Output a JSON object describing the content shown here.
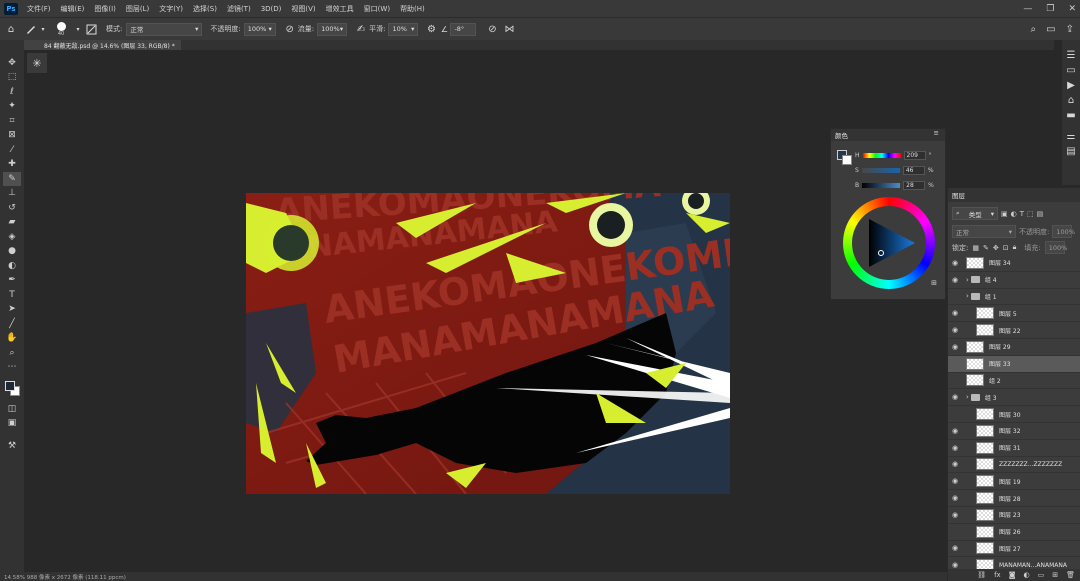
{
  "menubar": {
    "logo": "Ps",
    "items": [
      "文件(F)",
      "编辑(E)",
      "图像(I)",
      "图层(L)",
      "文字(Y)",
      "选择(S)",
      "滤镜(T)",
      "3D(D)",
      "视图(V)",
      "增效工具",
      "窗口(W)",
      "帮助(H)"
    ],
    "window_controls": [
      "—",
      "❐",
      "✕"
    ]
  },
  "options": {
    "brush_size": "40",
    "mode_label": "模式:",
    "mode_value": "正常",
    "opacity_label": "不透明度:",
    "opacity_value": "100%",
    "flow_label": "流量:",
    "flow_value": "100%",
    "smoothing_label": "平滑:",
    "smoothing_value": "10%",
    "angle_value": "-8°"
  },
  "document": {
    "tab_title": "84 翻蔽无敌.psd @ 14.6% (图层 33, RGB/8) *"
  },
  "canvas_text": {
    "line1": "ANEKOMAONEKOMA",
    "line2": "MANAMANAMANA",
    "line3": "ANEKOMAONEKOMI",
    "line4": "MANAMANAMANA"
  },
  "color_panel": {
    "title": "颜色",
    "h_label": "H",
    "h_value": "209",
    "h_unit": "°",
    "s_label": "S",
    "s_value": "46",
    "s_unit": "%",
    "b_label": "B",
    "b_value": "28",
    "b_unit": "%",
    "foreground_hex": "#26384a"
  },
  "layers_panel": {
    "title": "图层",
    "filter_label": "类型",
    "blend_mode": "正常",
    "opacity_label": "不透明度:",
    "opacity_value": "100%",
    "lock_label": "锁定:",
    "fill_label": "填充:",
    "fill_value": "100%",
    "layers": [
      {
        "name": "图层 34",
        "type": "layer",
        "indent": 0,
        "visible": true
      },
      {
        "name": "组 4",
        "type": "group",
        "indent": 0,
        "visible": true
      },
      {
        "name": "组 1",
        "type": "group",
        "indent": 0,
        "visible": false
      },
      {
        "name": "图层 5",
        "type": "layer",
        "indent": 1,
        "visible": true
      },
      {
        "name": "图层 22",
        "type": "layer",
        "indent": 1,
        "visible": true
      },
      {
        "name": "图层 29",
        "type": "layer",
        "indent": 0,
        "visible": true
      },
      {
        "name": "图层 33",
        "type": "layer",
        "indent": 0,
        "visible": false,
        "selected": true
      },
      {
        "name": "组 2",
        "type": "layer",
        "indent": 0,
        "visible": false
      },
      {
        "name": "组 3",
        "type": "group",
        "indent": 0,
        "visible": true
      },
      {
        "name": "图层 30",
        "type": "layer",
        "indent": 1,
        "visible": false
      },
      {
        "name": "图层 32",
        "type": "layer",
        "indent": 1,
        "visible": true
      },
      {
        "name": "图层 31",
        "type": "layer",
        "indent": 1,
        "visible": true
      },
      {
        "name": "ZZZZZZZ...ZZZZZZZ",
        "type": "layer",
        "indent": 1,
        "visible": true
      },
      {
        "name": "图层 19",
        "type": "layer",
        "indent": 1,
        "visible": true
      },
      {
        "name": "图层 28",
        "type": "layer",
        "indent": 1,
        "visible": true
      },
      {
        "name": "图层 23",
        "type": "layer",
        "indent": 1,
        "visible": true
      },
      {
        "name": "图层 26",
        "type": "layer",
        "indent": 1,
        "visible": false
      },
      {
        "name": "图层 27",
        "type": "layer",
        "indent": 1,
        "visible": true
      },
      {
        "name": "MANAMAN...ANAMANA",
        "type": "layer",
        "indent": 1,
        "visible": true
      }
    ]
  },
  "status": {
    "text": "14.58%   988 像素 x 2672 像素 (118.11 ppcm)"
  }
}
